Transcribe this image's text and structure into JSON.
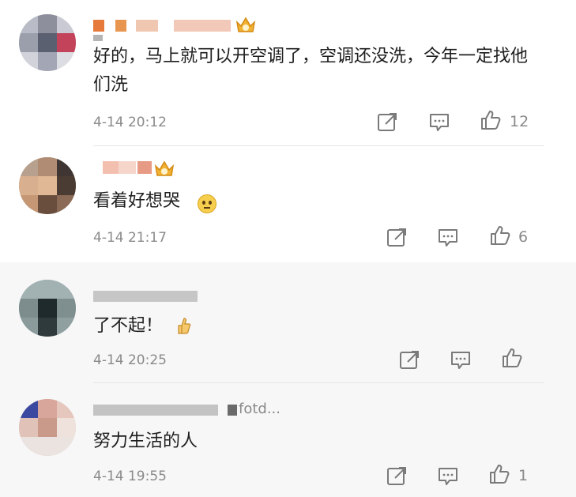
{
  "comments": [
    {
      "username": "",
      "text": "好的，马上就可以开空调了，空调还没洗，今年一定找他们洗",
      "time": "4-14 20:12",
      "likes": "12",
      "icons": [
        "share-icon",
        "comment-icon",
        "like-icon"
      ]
    },
    {
      "username": "",
      "text": "看着好想哭",
      "time": "4-14 21:17",
      "likes": "6",
      "icons": [
        "share-icon",
        "comment-icon",
        "like-icon"
      ]
    },
    {
      "username": "",
      "text": "了不起！",
      "time": "4-14 20:25",
      "likes": "",
      "icons": [
        "share-icon",
        "comment-icon",
        "like-icon"
      ]
    },
    {
      "username": "fotd...",
      "text": "努力生活的人",
      "time": "4-14 19:55",
      "likes": "1",
      "icons": [
        "share-icon",
        "comment-icon",
        "like-icon"
      ]
    }
  ],
  "colors": {
    "text": "#1e1e1e",
    "meta": "#8a8a8a",
    "reply_bg": "#f7f7f7",
    "crown": "#f2b233"
  }
}
